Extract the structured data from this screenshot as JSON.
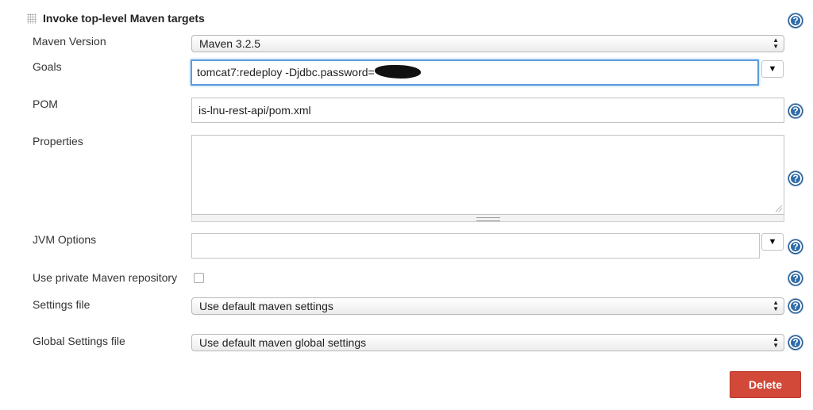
{
  "section": {
    "title": "Invoke top-level Maven targets",
    "help_glyph": "?"
  },
  "maven_version": {
    "label": "Maven Version",
    "value": "Maven 3.2.5"
  },
  "goals": {
    "label": "Goals",
    "value": "tomcat7:redeploy -Djdbc.password=",
    "expand_glyph": "▼"
  },
  "pom": {
    "label": "POM",
    "value": "is-lnu-rest-api/pom.xml"
  },
  "properties": {
    "label": "Properties",
    "value": ""
  },
  "jvm_options": {
    "label": "JVM Options",
    "value": "",
    "expand_glyph": "▼"
  },
  "private_repo": {
    "label": "Use private Maven repository",
    "checked": false
  },
  "settings_file": {
    "label": "Settings file",
    "value": "Use default maven settings"
  },
  "global_settings_file": {
    "label": "Global Settings file",
    "value": "Use default maven global settings"
  },
  "actions": {
    "delete_label": "Delete"
  },
  "select_arrows": "▲▼",
  "colors": {
    "delete_button": "#d24939",
    "help_icon": "#2e6ca8",
    "focus_ring": "#5b9ddd"
  }
}
